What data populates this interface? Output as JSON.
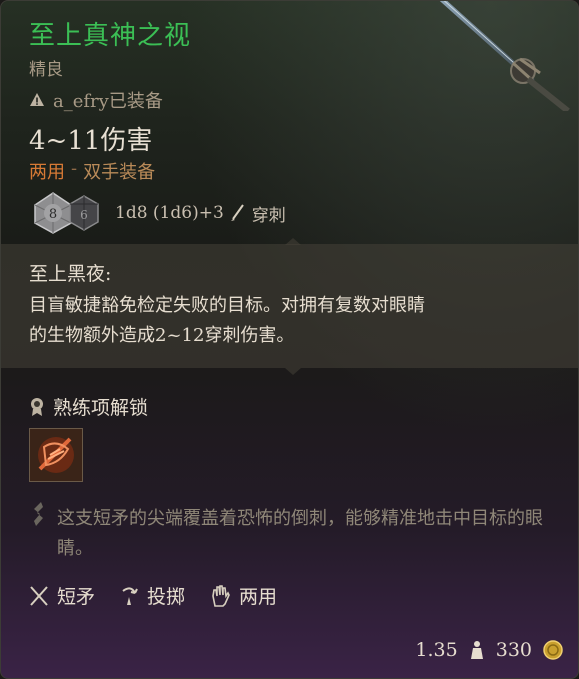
{
  "item": {
    "name": "至上真神之视",
    "rarity": "精良",
    "equipped_by": "a_efry已装备",
    "damage": "4~11伤害",
    "hands_primary": "两用",
    "hands_separator": "-",
    "hands_secondary": "双手装备",
    "dice_formula": "1d8 (1d6)+3",
    "damage_type": "穿刺",
    "dice_icons": [
      "d8-die-icon",
      "d6-die-icon"
    ]
  },
  "passive": {
    "title": "至上黑夜:",
    "description_line1": "目盲敏捷豁免检定失败的目标。对拥有复数对眼睛",
    "description_line2": "的生物额外造成2~12穿刺伤害。"
  },
  "proficiency": {
    "label": "熟练项解锁",
    "skill_icon": "piercing-strike-skill-icon"
  },
  "flavor": {
    "text": "这支短矛的尖端覆盖着恐怖的倒刺，能够精准地击中目标的眼睛。"
  },
  "properties": [
    {
      "label": "短矛",
      "icon": "crossed-spears-icon"
    },
    {
      "label": "投掷",
      "icon": "throw-icon"
    },
    {
      "label": "两用",
      "icon": "hand-icon"
    }
  ],
  "footer": {
    "weight": "1.35",
    "value": "330"
  },
  "colors": {
    "title_green": "#3bbf55",
    "hands_orange": "#d77a35",
    "text": "#e6ddcf",
    "muted": "#a89a86"
  }
}
